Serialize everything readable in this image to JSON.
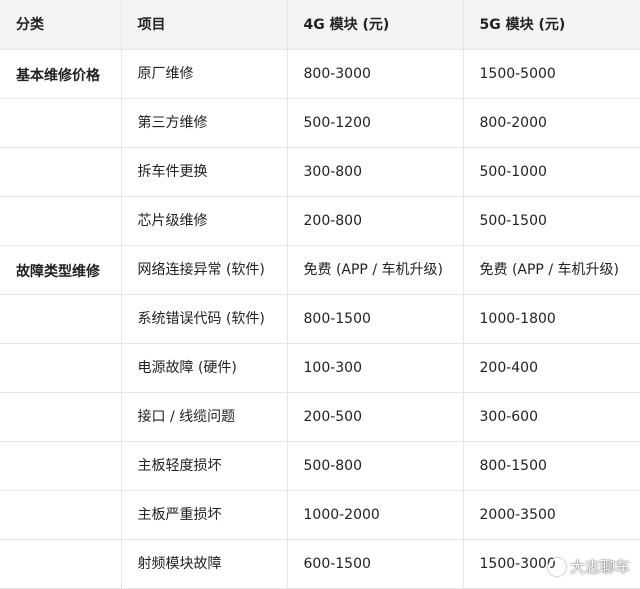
{
  "table": {
    "headers": [
      "分类",
      "项目",
      "4G 模块 (元)",
      "5G 模块 (元)"
    ],
    "rows": [
      {
        "category": "基本维修价格",
        "item": "原厂维修",
        "g4": "800-3000",
        "g5": "1500-5000"
      },
      {
        "category": "",
        "item": "第三方维修",
        "g4": "500-1200",
        "g5": "800-2000"
      },
      {
        "category": "",
        "item": "拆车件更换",
        "g4": "300-800",
        "g5": "500-1000"
      },
      {
        "category": "",
        "item": "芯片级维修",
        "g4": "200-800",
        "g5": "500-1500"
      },
      {
        "category": "故障类型维修",
        "item": "网络连接异常 (软件)",
        "g4": "免费 (APP / 车机升级)",
        "g5": "免费 (APP / 车机升级)"
      },
      {
        "category": "",
        "item": "系统错误代码 (软件)",
        "g4": "800-1500",
        "g5": "1000-1800"
      },
      {
        "category": "",
        "item": "电源故障 (硬件)",
        "g4": "100-300",
        "g5": "200-400"
      },
      {
        "category": "",
        "item": "接口 / 线缆问题",
        "g4": "200-500",
        "g5": "300-600"
      },
      {
        "category": "",
        "item": "主板轻度损坏",
        "g4": "500-800",
        "g5": "800-1500"
      },
      {
        "category": "",
        "item": "主板严重损坏",
        "g4": "1000-2000",
        "g5": "2000-3500"
      },
      {
        "category": "",
        "item": "射频模块故障",
        "g4": "600-1500",
        "g5": "1500-3000"
      }
    ]
  },
  "watermark": {
    "text": "大志聊车",
    "icon": "circle-logo-icon"
  }
}
